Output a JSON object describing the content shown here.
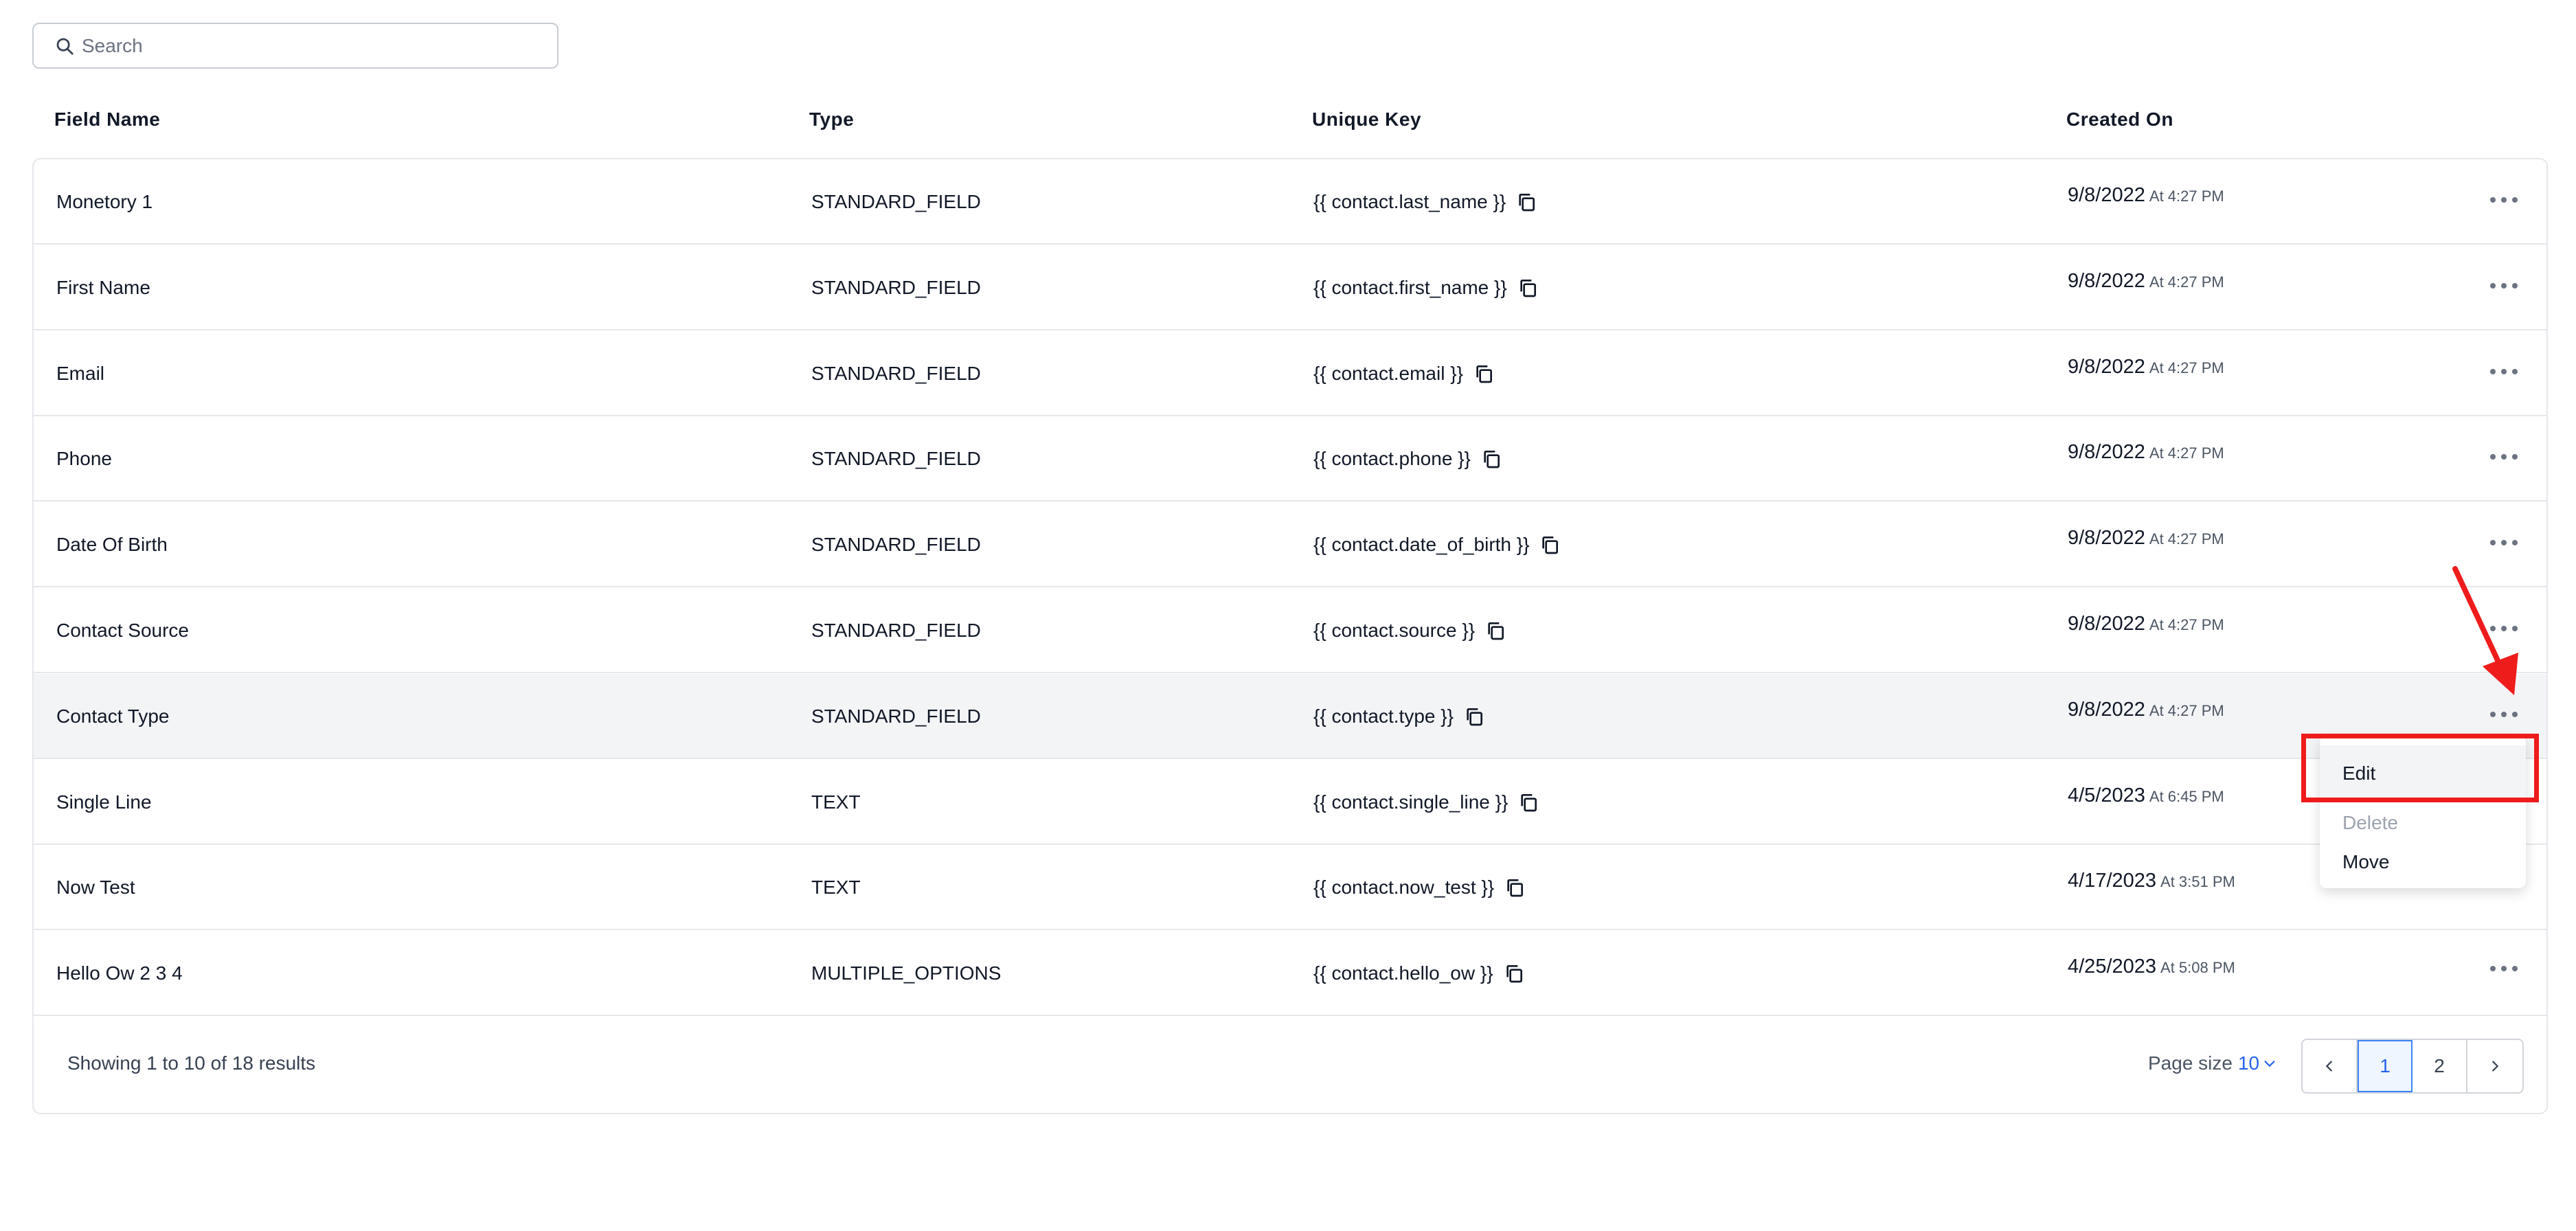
{
  "search": {
    "placeholder": "Search"
  },
  "columns": {
    "field_name": "Field Name",
    "type": "Type",
    "unique_key": "Unique Key",
    "created_on": "Created On"
  },
  "rows": [
    {
      "name": "Monetory 1",
      "type": "STANDARD_FIELD",
      "key": "{{ contact.last_name }}",
      "date": "9/8/2022",
      "time": "At 4:27 PM"
    },
    {
      "name": "First Name",
      "type": "STANDARD_FIELD",
      "key": "{{ contact.first_name }}",
      "date": "9/8/2022",
      "time": "At 4:27 PM"
    },
    {
      "name": "Email",
      "type": "STANDARD_FIELD",
      "key": "{{ contact.email }}",
      "date": "9/8/2022",
      "time": "At 4:27 PM"
    },
    {
      "name": "Phone",
      "type": "STANDARD_FIELD",
      "key": "{{ contact.phone }}",
      "date": "9/8/2022",
      "time": "At 4:27 PM"
    },
    {
      "name": "Date Of Birth",
      "type": "STANDARD_FIELD",
      "key": "{{ contact.date_of_birth }}",
      "date": "9/8/2022",
      "time": "At 4:27 PM"
    },
    {
      "name": "Contact Source",
      "type": "STANDARD_FIELD",
      "key": "{{ contact.source }}",
      "date": "9/8/2022",
      "time": "At 4:27 PM"
    },
    {
      "name": "Contact Type",
      "type": "STANDARD_FIELD",
      "key": "{{ contact.type }}",
      "date": "9/8/2022",
      "time": "At 4:27 PM"
    },
    {
      "name": "Single Line",
      "type": "TEXT",
      "key": "{{ contact.single_line }}",
      "date": "4/5/2023",
      "time": "At 6:45 PM"
    },
    {
      "name": "Now Test",
      "type": "TEXT",
      "key": "{{ contact.now_test }}",
      "date": "4/17/2023",
      "time": "At 3:51 PM"
    },
    {
      "name": "Hello Ow 2 3 4",
      "type": "MULTIPLE_OPTIONS",
      "key": "{{ contact.hello_ow }}",
      "date": "4/25/2023",
      "time": "At 5:08 PM"
    }
  ],
  "menu": {
    "edit": "Edit",
    "delete": "Delete",
    "move": "Move"
  },
  "footer": {
    "showing_prefix": "Showing",
    "from": "1",
    "to_word": "to",
    "to": "10",
    "of_word": "of",
    "total": "18",
    "results_word": "results",
    "page_size_label": "Page size",
    "page_size": "10",
    "pages": [
      "1",
      "2"
    ],
    "current_page": "1"
  },
  "colors": {
    "accent": "#2563eb",
    "highlight_box": "#ef1c1c",
    "row_hover": "#f3f4f6"
  },
  "icons": {
    "search": "search-icon",
    "copy": "copy-icon",
    "more": "more-horizontal-icon",
    "prev": "chevron-left-icon",
    "next": "chevron-right-icon"
  }
}
